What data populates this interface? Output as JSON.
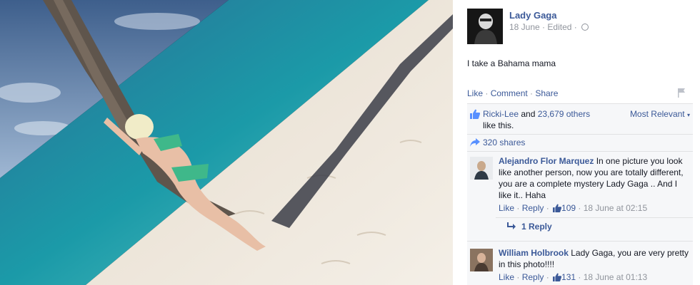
{
  "photo": {
    "alt_semantic": "beach-photo",
    "colors": {
      "sky": "#6f8fb8",
      "sea": "#1a8aa0",
      "sand": "#efe8dc",
      "shadow": "#3b3d48",
      "swimsuit": "#3fb88a",
      "trunk": "#5f554c"
    }
  },
  "post": {
    "author": "Lady Gaga",
    "date": "18 June",
    "edited": "Edited",
    "caption": "I take a Bahama mama",
    "actions": {
      "like": "Like",
      "comment": "Comment",
      "share": "Share",
      "separator": " · "
    }
  },
  "likes": {
    "first_liker": "Ricki-Lee",
    "and_text": " and ",
    "others": "23,679 others",
    "suffix": " like this.",
    "sort": "Most Relevant"
  },
  "shares": {
    "label": "320 shares"
  },
  "comments": [
    {
      "author": "Alejandro Flor Marquez",
      "text": " In one picture you look like another person, now you are totally different, you are a complete mystery Lady Gaga .. And I like it.. Haha",
      "like": "Like",
      "reply": "Reply",
      "likes": "109",
      "time": "18 June at 02:15"
    },
    {
      "author": "William Holbrook",
      "text": " Lady Gaga, you are very pretty in this photo!!!!",
      "like": "Like",
      "reply": "Reply",
      "likes": "131",
      "time": "18 June at 01:13"
    }
  ],
  "replies": {
    "label": "1 Reply"
  },
  "colors": {
    "link": "#3b5998",
    "muted": "#90949c",
    "ufi_bg": "#f6f7f9"
  }
}
